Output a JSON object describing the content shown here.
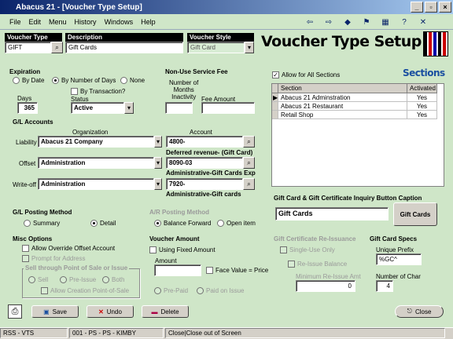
{
  "window": {
    "title": "Abacus 21 - [Voucher Type Setup]"
  },
  "menu": [
    "File",
    "Edit",
    "Menu",
    "History",
    "Windows",
    "Help"
  ],
  "page_title": "Voucher Type Setup",
  "sections_title": "Sections",
  "header_fields": {
    "voucher_type_label": "Voucher Type",
    "voucher_type_value": "GIFT",
    "description_label": "Description",
    "description_value": "Gift Cards",
    "voucher_style_label": "Voucher Style",
    "voucher_style_value": "Gift Card"
  },
  "expiration": {
    "label": "Expiration",
    "by_date": "By Date",
    "by_days": "By Number of Days",
    "none": "None",
    "by_transaction": "By Transaction?",
    "days_label": "Days",
    "days_value": "365",
    "status_label": "Status",
    "status_value": "Active"
  },
  "non_use": {
    "label": "Non-Use Service Fee",
    "months_label_1": "Number of",
    "months_label_2": "Months",
    "months_label_3": "Inactivity",
    "fee_label": "Fee Amount"
  },
  "allow_all_sections": "Allow for All Sections",
  "sections_table": {
    "headers": [
      "Section",
      "Activated"
    ],
    "rows": [
      {
        "section": "Abacus 21 Adminstration",
        "activated": "Yes"
      },
      {
        "section": "Abacus 21 Restaurant",
        "activated": "Yes"
      },
      {
        "section": "Retail Shop",
        "activated": "Yes"
      }
    ]
  },
  "gl": {
    "label": "G/L Accounts",
    "org_header": "Organization",
    "acct_header": "Account",
    "liability_label": "Liability",
    "liability_org": "Abacus 21 Company",
    "liability_acct": "4800-",
    "liability_desc": "Deferred revenue- (Gift Card)",
    "offset_label": "Offset",
    "offset_org": "Administration",
    "offset_acct": "8090-03",
    "offset_desc": "Administrative-Gift Cards Exp",
    "writeoff_label": "Write-off",
    "writeoff_org": "Administration",
    "writeoff_acct": "7920-",
    "writeoff_desc": "Administrative-Gift cards"
  },
  "caption": {
    "label": "Gift Card & Gift Certificate Inquiry Button Caption",
    "value": "Gift Cards",
    "button": "Gift Cards"
  },
  "gl_posting": {
    "label": "G/L Posting Method",
    "summary": "Summary",
    "detail": "Detail"
  },
  "ar_posting": {
    "label": "A/R Posting Method",
    "balance_forward": "Balance Forward",
    "open_item": "Open item"
  },
  "misc": {
    "label": "Misc Options",
    "allow_override": "Allow Override Offset Account",
    "prompt_address": "Prompt for Address",
    "sell_through": "Sell through Point of Sale or Issue",
    "sell": "Sell",
    "pre_issue": "Pre-Issue",
    "both": "Both",
    "allow_creation": "Allow Creation Point-of-Sale"
  },
  "voucher_amount": {
    "label": "Voucher Amount",
    "use_fixed": "Using Fixed Amount",
    "amount_label": "Amount",
    "face_value": "Face Value = Price",
    "pre_paid": "Pre-Paid",
    "paid_on_issue": "Paid on Issue"
  },
  "gift_cert": {
    "label": "Gift Certificate Re-Issuance",
    "single_use": "Single-Use Only",
    "reissue_balance": "Re-Issue Balance",
    "min_amt_label": "Minimum Re-Issue Amt",
    "min_amt_value": "0"
  },
  "gift_card_specs": {
    "label": "Gift Card Specs",
    "prefix_label": "Unique Prefix",
    "prefix_value": "%GC^",
    "num_char_label": "Number of Char",
    "num_char_value": "4"
  },
  "buttons": {
    "save": "Save",
    "undo": "Undo",
    "delete": "Delete",
    "close": "Close"
  },
  "status": {
    "left": "RSS - VTS",
    "mid": "001 - PS - PS - KIMBY",
    "msg": "Close|Close out of Screen"
  }
}
